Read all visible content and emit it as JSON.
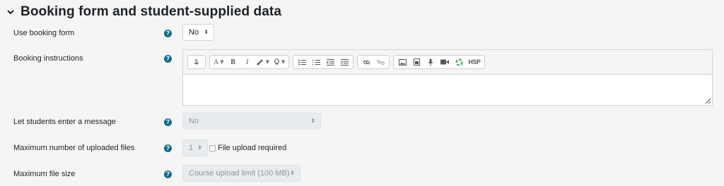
{
  "section": {
    "title": "Booking form and student-supplied data"
  },
  "fields": {
    "use_booking_form": {
      "label": "Use booking form",
      "value": "No"
    },
    "booking_instructions": {
      "label": "Booking instructions"
    },
    "student_message": {
      "label": "Let students enter a message",
      "value": "No"
    },
    "max_files": {
      "label": "Maximum number of uploaded files",
      "value": "1",
      "checkbox_label": "File upload required"
    },
    "max_size": {
      "label": "Maximum file size",
      "value": "Course upload limit (100 MB)"
    }
  },
  "help_glyph": "?",
  "select_arrows": "⬍",
  "toolbar": {
    "groups": [
      [
        "collapse-icon"
      ],
      [
        "font-style-icon",
        "bold-icon",
        "italic-icon",
        "font-color-icon",
        "background-color-icon"
      ],
      [
        "unordered-list-icon",
        "ordered-list-icon",
        "outdent-icon",
        "indent-icon"
      ],
      [
        "link-icon",
        "unlink-icon"
      ],
      [
        "image-icon",
        "media-icon",
        "record-audio-icon",
        "record-video-icon",
        "manage-files-icon",
        "h5p-icon"
      ]
    ],
    "text": {
      "font": "A",
      "bold": "B",
      "italic": "I",
      "h5p": "H5P"
    }
  },
  "colors": {
    "help": "#0f6b8a",
    "background": "#f5f5f5"
  }
}
